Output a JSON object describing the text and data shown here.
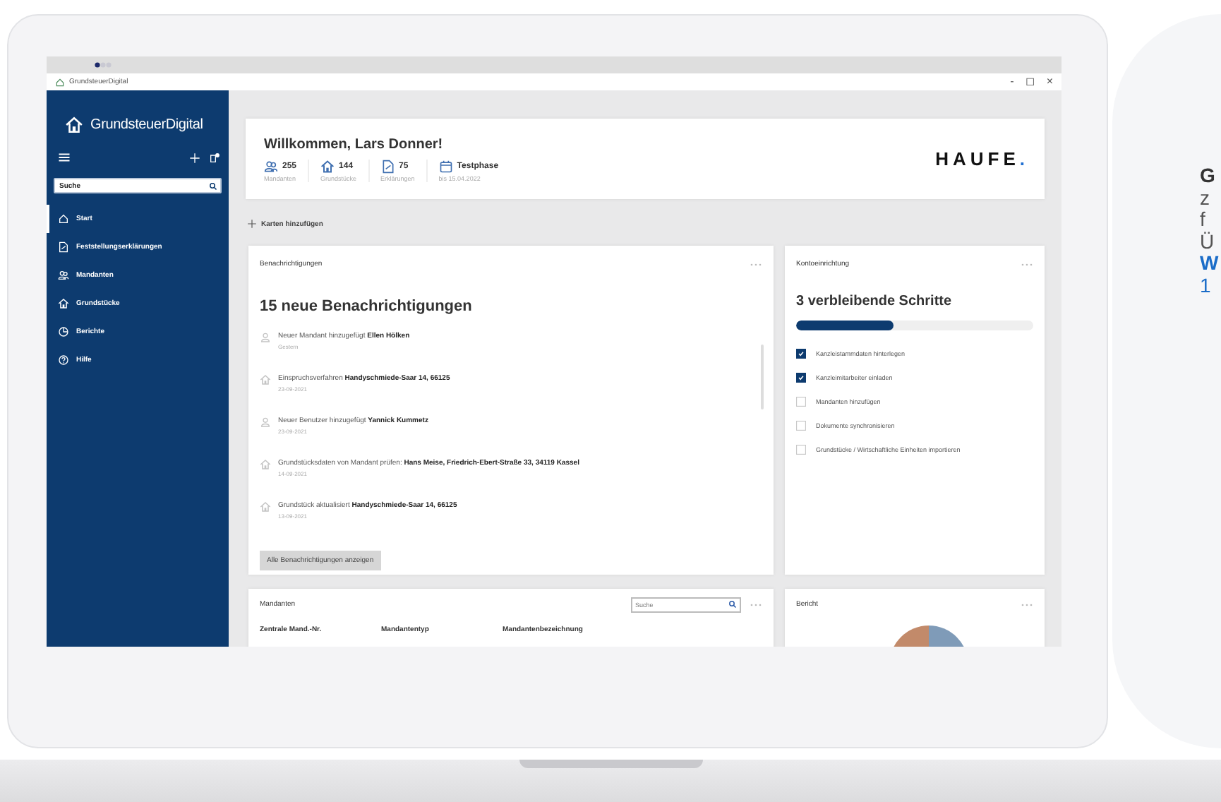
{
  "window": {
    "title": "GrundsteuerDigital",
    "controls": [
      "-",
      "◻",
      "×"
    ]
  },
  "sidebar": {
    "logo": "GrundsteuerDigital",
    "search": {
      "value": "Suche"
    },
    "items": [
      {
        "kind": "home",
        "label": "Start",
        "selected": true
      },
      {
        "kind": "document",
        "label": "Feststellungserklärungen",
        "selected": false
      },
      {
        "kind": "people",
        "label": "Mandanten",
        "selected": false
      },
      {
        "kind": "house",
        "label": "Grundstücke",
        "selected": false
      },
      {
        "kind": "chart",
        "label": "Berichte",
        "selected": false
      },
      {
        "kind": "help",
        "label": "Hilfe",
        "selected": false
      }
    ]
  },
  "welcome": {
    "title": "Willkommen, Lars Donner!",
    "stats": [
      {
        "kind": "people",
        "value": "255",
        "label": "Mandanten"
      },
      {
        "kind": "house",
        "value": "144",
        "label": "Grundstücke"
      },
      {
        "kind": "document",
        "value": "75",
        "label": "Erklärungen"
      },
      {
        "kind": "calendar",
        "value": "Testphase",
        "label": "bis 15.04.2022"
      }
    ],
    "brand": {
      "name": "HAUFE",
      "mark": "."
    }
  },
  "add_cards": "Karten hinzufügen",
  "notifications": {
    "header": "Benachrichtigungen",
    "title": "15 neue Benachrichtigungen",
    "items": [
      {
        "kind": "person",
        "text": "Neuer Mandant hinzugefügt **Ellen Hölken**",
        "date": "Gestern"
      },
      {
        "kind": "house",
        "text": "Einspruchsverfahren **Handyschmiede-Saar 14, 66125**",
        "date": "23-09-2021"
      },
      {
        "kind": "person",
        "text": "Neuer Benutzer hinzugefügt **Yannick Kummetz**",
        "date": "23-09-2021"
      },
      {
        "kind": "house",
        "text": "Grundstücksdaten von Mandant prüfen: **Hans Meise, Friedrich-Ebert-Straße 33, 34119 Kassel**",
        "date": "14-09-2021"
      },
      {
        "kind": "house",
        "text": "Grundstück aktualisiert **Handyschmiede-Saar 14, 66125**",
        "date": "13-09-2021"
      }
    ],
    "button": "Alle Benachrichtigungen anzeigen"
  },
  "setup": {
    "header": "Kontoeinrichtung",
    "title": "3 verbleibende Schritte",
    "level": 0.41,
    "steps": [
      {
        "label": "Kanzleistammdaten hinterlegen",
        "checked": true
      },
      {
        "label": "Kanzleimitarbeiter einladen",
        "checked": true
      },
      {
        "label": "Mandanten hinzufügen",
        "checked": false
      },
      {
        "label": "Dokumente synchronisieren",
        "checked": false
      },
      {
        "label": "Grundstücke / Wirtschaftliche Einheiten importieren",
        "checked": false
      }
    ]
  },
  "clients": {
    "header": "Mandanten",
    "search": {
      "placeholder": "Suche"
    },
    "columns": [
      "Zentrale Mand.-Nr.",
      "Mandantentyp",
      "Mandantenbezeichnung"
    ]
  },
  "report": {
    "header": "Bericht"
  },
  "promo": {
    "lines": [
      {
        "kind": "heading",
        "text": "G"
      },
      {
        "kind": "body",
        "text": "z"
      },
      {
        "kind": "body",
        "text": "f"
      },
      {
        "kind": "body",
        "text": "Ü"
      },
      {
        "kind": "link",
        "text": "W"
      },
      {
        "kind": "accent",
        "text": "1"
      }
    ]
  }
}
